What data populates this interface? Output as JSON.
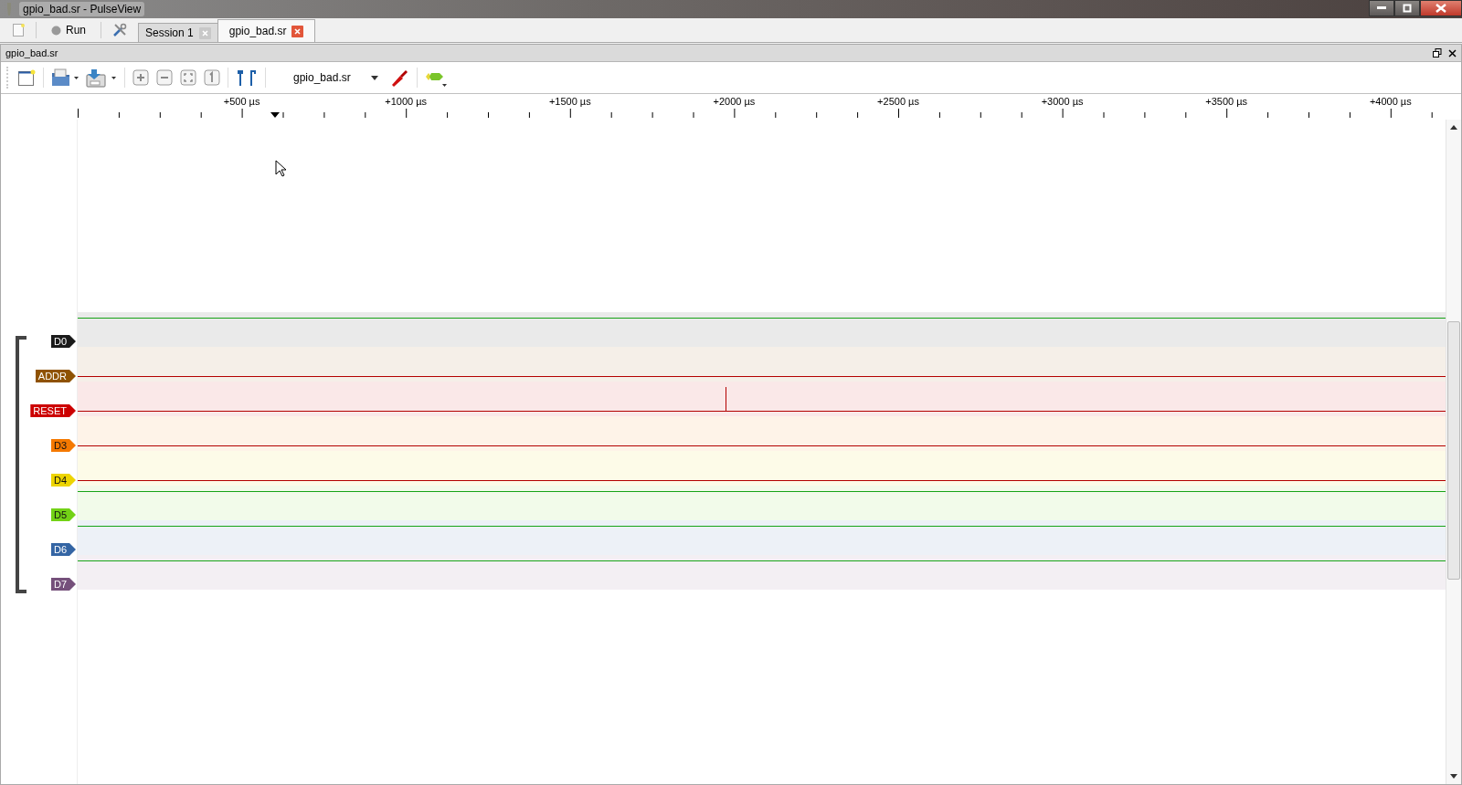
{
  "window": {
    "title": "gpio_bad.sr - PulseView"
  },
  "main_toolbar": {
    "run_label": "Run"
  },
  "tabs": [
    {
      "label": "Session 1",
      "selected": false
    },
    {
      "label": "gpio_bad.sr",
      "selected": true
    }
  ],
  "panel": {
    "title": "gpio_bad.sr"
  },
  "toolbar": {
    "device": "gpio_bad.sr"
  },
  "ruler": {
    "labels": [
      "+500 µs",
      "+1000 µs",
      "+1500 µs",
      "+2000 µs",
      "+2500 µs",
      "+3000 µs",
      "+3500 µs",
      "+4000 µs"
    ]
  },
  "channels": [
    {
      "name": "D0",
      "color": "#1a1a1a",
      "high": true,
      "spike": false
    },
    {
      "name": "ADDR",
      "color": "#8f5202",
      "high": false,
      "spike": false
    },
    {
      "name": "RESET",
      "color": "#cc0000",
      "high": false,
      "spike": true
    },
    {
      "name": "D3",
      "color": "#f57900",
      "high": false,
      "spike": false
    },
    {
      "name": "D4",
      "color": "#edd400",
      "high": false,
      "spike": false
    },
    {
      "name": "D5",
      "color": "#73d216",
      "high": true,
      "spike": false
    },
    {
      "name": "D6",
      "color": "#3465a4",
      "high": true,
      "spike": false
    },
    {
      "name": "D7",
      "color": "#75507b",
      "high": true,
      "spike": false
    }
  ]
}
